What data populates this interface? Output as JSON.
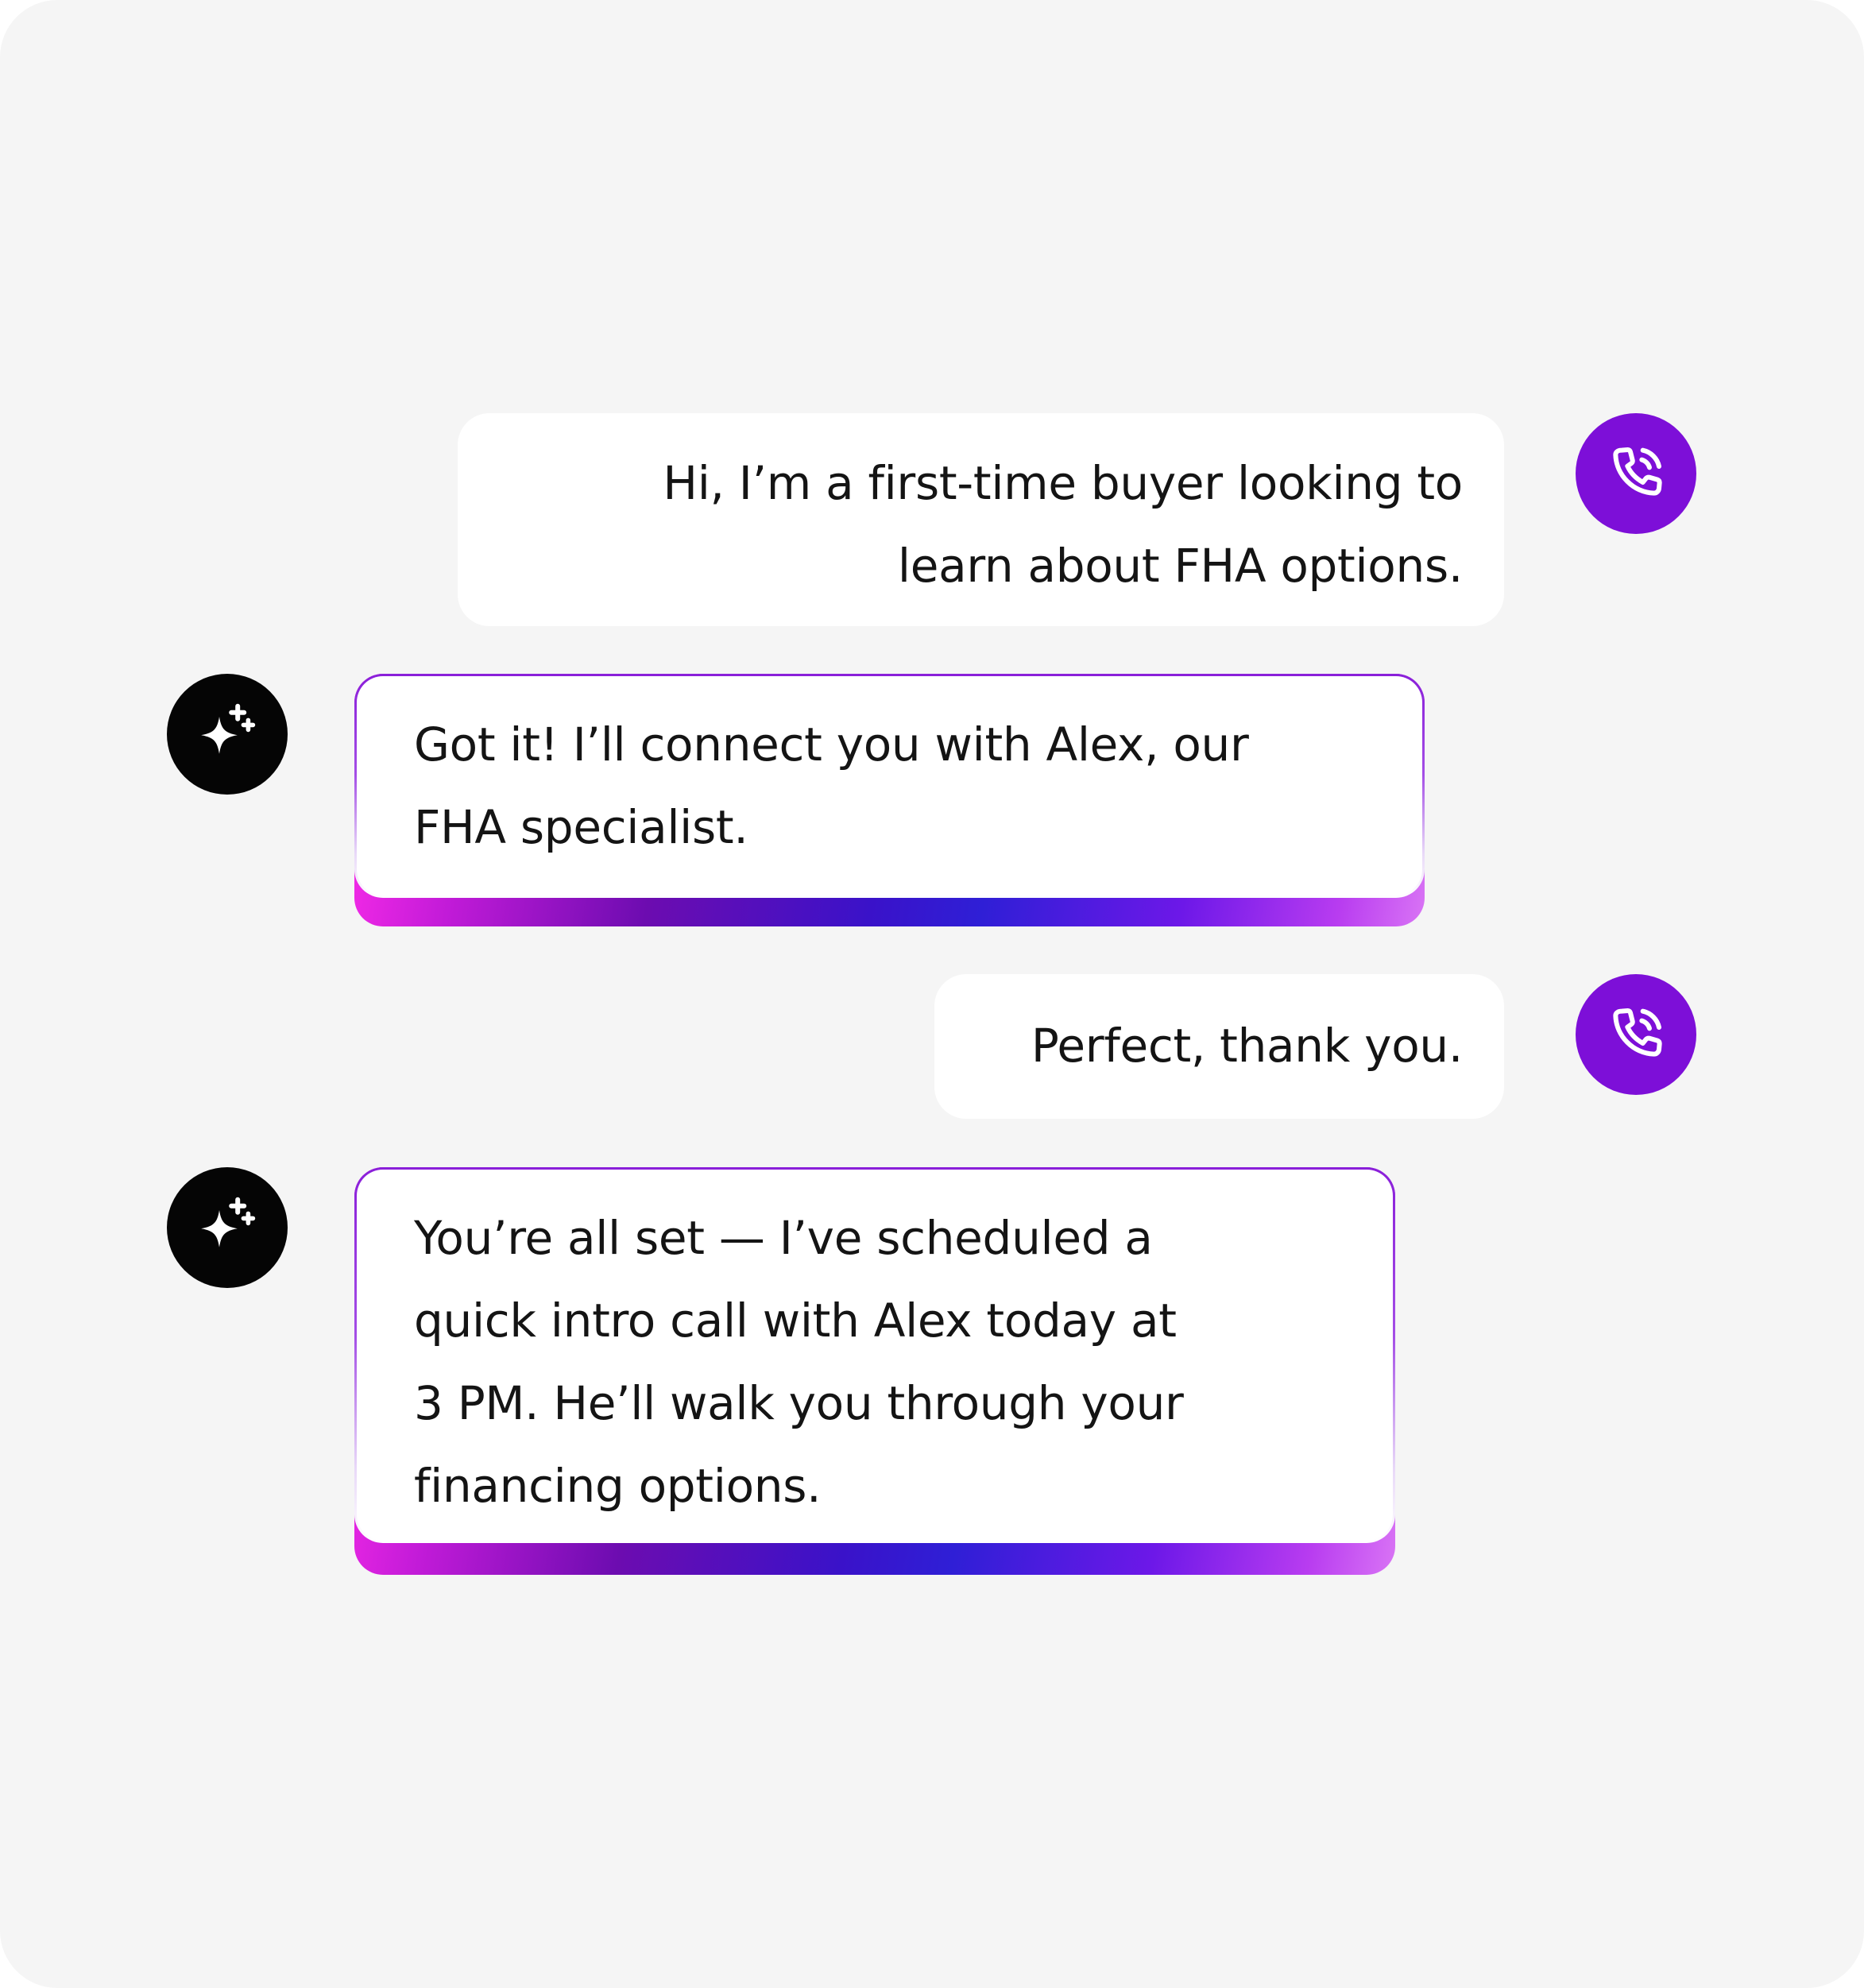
{
  "colors": {
    "background": "#f5f5f5",
    "user_bubble": "#ffffff",
    "phone_avatar": "#7d0fd8",
    "ai_avatar": "#050505",
    "text": "#141414"
  },
  "conversation": {
    "messages": [
      {
        "role": "caller",
        "avatar_icon": "phone-call-icon",
        "lines": [
          "Hi, I’m a first-time buyer looking to",
          "learn about FHA options."
        ]
      },
      {
        "role": "assistant",
        "avatar_icon": "sparkles-icon",
        "lines": [
          "Got it! I’ll connect you with Alex, our",
          "FHA specialist."
        ]
      },
      {
        "role": "caller",
        "avatar_icon": "phone-call-icon",
        "lines": [
          "Perfect, thank you."
        ]
      },
      {
        "role": "assistant",
        "avatar_icon": "sparkles-icon",
        "lines": [
          "You’re all set — I’ve scheduled a",
          "quick intro call with Alex today at",
          "3 PM. He’ll walk you through your",
          "financing options."
        ]
      }
    ]
  }
}
